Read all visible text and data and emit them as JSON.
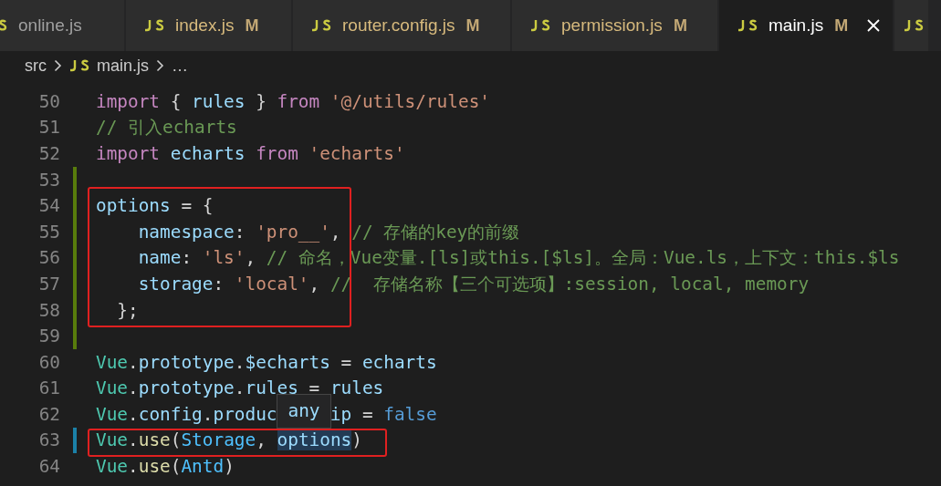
{
  "tabs": [
    {
      "label": "online.js",
      "modified": false,
      "selected": false
    },
    {
      "label": "index.js",
      "modified": true,
      "badge": "M",
      "selected": false
    },
    {
      "label": "router.config.js",
      "modified": true,
      "badge": "M",
      "selected": false
    },
    {
      "label": "permission.js",
      "modified": true,
      "badge": "M",
      "selected": false
    },
    {
      "label": "main.js",
      "modified": true,
      "badge": "M",
      "selected": true
    },
    {
      "selected": false
    }
  ],
  "breadcrumb": {
    "folder": "src",
    "file": "main.js",
    "more": "…"
  },
  "lines": [
    {
      "number": "50",
      "tokens": [
        {
          "kind": "keyword",
          "text": "import"
        },
        {
          "kind": "punct",
          "text": " { "
        },
        {
          "kind": "variable",
          "text": "rules"
        },
        {
          "kind": "punct",
          "text": " } "
        },
        {
          "kind": "keyword",
          "text": "from"
        },
        {
          "kind": "string",
          "text": " '@/utils/rules'"
        }
      ]
    },
    {
      "number": "51",
      "tokens": [
        {
          "kind": "comment",
          "text": "// 引入echarts"
        }
      ]
    },
    {
      "number": "52",
      "tokens": [
        {
          "kind": "keyword",
          "text": "import"
        },
        {
          "kind": "variable",
          "text": " echarts"
        },
        {
          "kind": "keyword",
          "text": " from"
        },
        {
          "kind": "string",
          "text": " 'echarts'"
        }
      ]
    },
    {
      "number": "53",
      "added": true
    },
    {
      "number": "54",
      "added": true,
      "tokens": [
        {
          "kind": "variable",
          "text": "options"
        },
        {
          "kind": "punct",
          "text": " = {"
        }
      ]
    },
    {
      "number": "55",
      "added": true,
      "tokens": [
        {
          "kind": "variable",
          "text": "    namespace"
        },
        {
          "kind": "punct",
          "text": ": "
        },
        {
          "kind": "string",
          "text": "'pro__'"
        },
        {
          "kind": "punct",
          "text": ", "
        },
        {
          "kind": "comment",
          "text": "// 存储的key的前缀"
        }
      ]
    },
    {
      "number": "56",
      "added": true,
      "tokens": [
        {
          "kind": "variable",
          "text": "    name"
        },
        {
          "kind": "punct",
          "text": ": "
        },
        {
          "kind": "string",
          "text": "'ls'"
        },
        {
          "kind": "punct",
          "text": ", "
        },
        {
          "kind": "comment",
          "text": "// 命名，Vue变量.[ls]或this.[$ls]。全局：Vue.ls，上下文：this.$ls"
        }
      ]
    },
    {
      "number": "57",
      "added": true,
      "tokens": [
        {
          "kind": "variable",
          "text": "    storage"
        },
        {
          "kind": "punct",
          "text": ": "
        },
        {
          "kind": "string",
          "text": "'local'"
        },
        {
          "kind": "punct",
          "text": ", "
        },
        {
          "kind": "comment",
          "text": "//  存储名称【三个可选项】:session, local, memory"
        }
      ]
    },
    {
      "number": "58",
      "added": true,
      "tokens": [
        {
          "kind": "punct",
          "text": "  };"
        }
      ]
    },
    {
      "number": "59",
      "added": true
    },
    {
      "number": "60",
      "tokens": [
        {
          "kind": "class",
          "text": "Vue"
        },
        {
          "kind": "punct",
          "text": "."
        },
        {
          "kind": "variable",
          "text": "prototype"
        },
        {
          "kind": "punct",
          "text": "."
        },
        {
          "kind": "variable",
          "text": "$echarts"
        },
        {
          "kind": "punct",
          "text": " = "
        },
        {
          "kind": "variable",
          "text": "echarts"
        }
      ]
    },
    {
      "number": "61",
      "tokens": [
        {
          "kind": "class",
          "text": "Vue"
        },
        {
          "kind": "punct",
          "text": "."
        },
        {
          "kind": "variable",
          "text": "prototype"
        },
        {
          "kind": "punct",
          "text": "."
        },
        {
          "kind": "variable",
          "text": "rules"
        },
        {
          "kind": "punct",
          "text": " = "
        },
        {
          "kind": "variable",
          "text": "rules"
        }
      ]
    },
    {
      "number": "62",
      "tokens": [
        {
          "kind": "class",
          "text": "Vue"
        },
        {
          "kind": "punct",
          "text": "."
        },
        {
          "kind": "variable",
          "text": "config"
        },
        {
          "kind": "punct",
          "text": "."
        },
        {
          "kind": "variable",
          "text": "produc"
        },
        {
          "kind": "covered"
        },
        {
          "kind": "variable",
          "text": "ip"
        },
        {
          "kind": "punct",
          "text": " = "
        },
        {
          "kind": "boolean",
          "text": "false"
        }
      ]
    },
    {
      "number": "63",
      "modified": true,
      "tokens": [
        {
          "kind": "class",
          "text": "Vue"
        },
        {
          "kind": "punct",
          "text": "."
        },
        {
          "kind": "function",
          "text": "use"
        },
        {
          "kind": "punct",
          "text": "("
        },
        {
          "kind": "constant",
          "text": "Storage"
        },
        {
          "kind": "punct",
          "text": ", "
        },
        {
          "kind": "variable",
          "text": "options",
          "hovered": true
        },
        {
          "kind": "punct",
          "text": ")"
        }
      ]
    },
    {
      "number": "64",
      "tokens": [
        {
          "kind": "class",
          "text": "Vue"
        },
        {
          "kind": "punct",
          "text": "."
        },
        {
          "kind": "function",
          "text": "use"
        },
        {
          "kind": "punct",
          "text": "("
        },
        {
          "kind": "constant",
          "text": "Antd"
        },
        {
          "kind": "punct",
          "text": ")"
        }
      ]
    }
  ],
  "hover_tooltip": {
    "text": "any"
  }
}
